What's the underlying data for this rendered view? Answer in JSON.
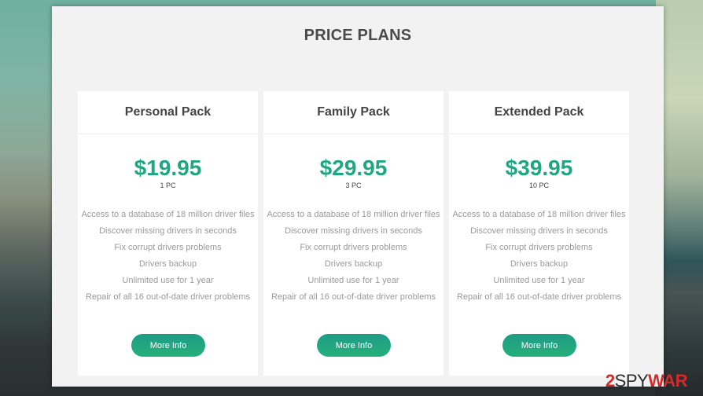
{
  "page": {
    "title": "PRICE PLANS"
  },
  "plans": [
    {
      "name": "Personal Pack",
      "price": "$19.95",
      "units": "1 PC",
      "features": [
        "Access to a database of 18 million driver files",
        "Discover missing drivers in seconds",
        "Fix corrupt drivers problems",
        "Drivers backup",
        "Unlimited use for 1 year",
        "Repair of all 16 out-of-date driver problems"
      ],
      "button_label": "More Info"
    },
    {
      "name": "Family Pack",
      "price": "$29.95",
      "units": "3 PC",
      "features": [
        "Access to a database of 18 million driver files",
        "Discover missing drivers in seconds",
        "Fix corrupt drivers problems",
        "Drivers backup",
        "Unlimited use for 1 year",
        "Repair of all 16 out-of-date driver problems"
      ],
      "button_label": "More Info"
    },
    {
      "name": "Extended Pack",
      "price": "$39.95",
      "units": "10 PC",
      "features": [
        "Access to a database of 18 million driver files",
        "Discover missing drivers in seconds",
        "Fix corrupt drivers problems",
        "Drivers backup",
        "Unlimited use for 1 year",
        "Repair of all 16 out-of-date driver problems"
      ],
      "button_label": "More Info"
    }
  ],
  "watermark": {
    "prefix": "2",
    "middle": "SPY",
    "suffix": "WAR"
  },
  "colors": {
    "accent": "#1fa783",
    "button_top": "#1f9c86",
    "button_bottom": "#25b07a",
    "watermark_red": "#d42a2a"
  }
}
